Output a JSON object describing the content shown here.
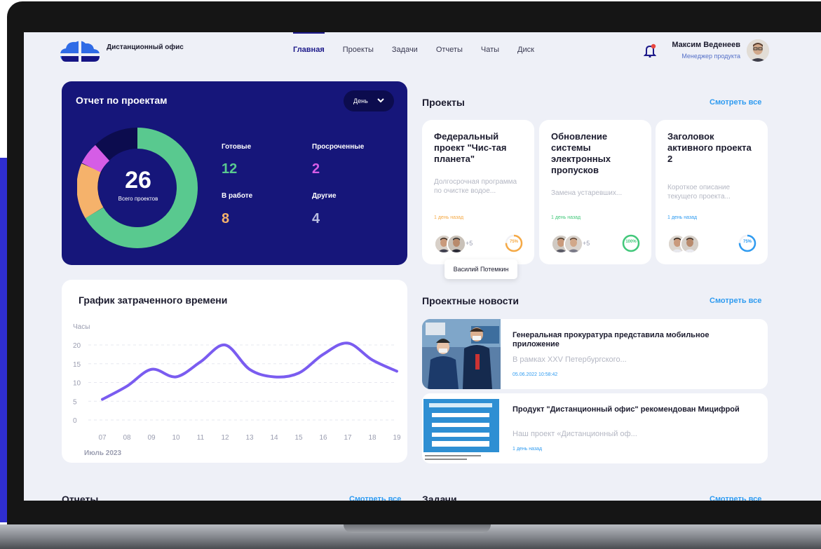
{
  "app": {
    "logo_text": "Дистанционный офис"
  },
  "nav": {
    "items": [
      {
        "label": "Главная",
        "active": true
      },
      {
        "label": "Проекты"
      },
      {
        "label": "Задачи"
      },
      {
        "label": "Отчеты"
      },
      {
        "label": "Чаты"
      },
      {
        "label": "Диск"
      }
    ]
  },
  "user": {
    "name": "Максим Веденеев",
    "role": "Менеджер продукта"
  },
  "report": {
    "title": "Отчет по проектам",
    "period": "День",
    "total": "26",
    "total_label": "Всего проектов",
    "stats": {
      "ready_label": "Готовые",
      "ready": "12",
      "overdue_label": "Просроченные",
      "overdue": "2",
      "in_work_label": "В работе",
      "in_work": "8",
      "other_label": "Другие",
      "other": "4"
    },
    "colors": {
      "ready": "#59c98f",
      "overdue": "#d55de6",
      "in_work": "#f5b26b",
      "other": "#0c0c4e"
    }
  },
  "projects": {
    "title": "Проекты",
    "see_all": "Смотреть все",
    "cards": [
      {
        "title": "Федеральный проект \"Чис-тая планета\"",
        "desc": "Долгосрочная программа по очистке водое...",
        "time": "1 день назад",
        "extra": "+5",
        "progress": "75%",
        "color": "#f5a945"
      },
      {
        "title": "Обновление системы электронных пропусков",
        "desc": "Замена устаревших...",
        "time": "1 день назад",
        "extra": "+5",
        "progress": "100%",
        "color": "#42c87a"
      },
      {
        "title": "Заголовок активного проекта 2",
        "desc": "Короткое описание текущего проекта...",
        "time": "1 день назад",
        "extra": "",
        "progress": "75%",
        "color": "#2f9bf0"
      }
    ],
    "tooltip": "Василий Потемкин"
  },
  "chart": {
    "title": "График затраченного времени",
    "ylabel": "Часы",
    "xlabel": "Июль 2023"
  },
  "chart_data": {
    "type": "line",
    "title": "График затраченного времени",
    "ylabel": "Часы",
    "xlabel": "Июль 2023",
    "x": [
      "07",
      "08",
      "09",
      "10",
      "11",
      "12",
      "13",
      "14",
      "15",
      "16",
      "17",
      "18",
      "19"
    ],
    "yticks": [
      0,
      5,
      10,
      15,
      20
    ],
    "ylim": [
      0,
      20
    ],
    "series": [
      {
        "color": "#7a5cf0",
        "values": [
          5.5,
          9,
          13.5,
          11.5,
          15.5,
          20,
          13.5,
          11.5,
          12.5,
          17.5,
          20.5,
          16,
          13
        ]
      }
    ],
    "grid": true
  },
  "news": {
    "title": "Проектные новости",
    "see_all": "Смотреть все",
    "items": [
      {
        "title": "Генеральная прокуратура представила мобильное приложение",
        "desc": "В рамках XXV Петербургского...",
        "date": "05.06.2022 10:58:42"
      },
      {
        "title": "Продукт \"Дистанционный офис\" рекомендован Мицифрой",
        "desc": "Наш проект «Дистанционный оф...",
        "date": "1 день назад"
      }
    ]
  },
  "bottom": {
    "reports_title": "Отчеты",
    "reports_see_all": "Смотреть все",
    "tasks_title": "Задачи",
    "tasks_see_all": "Смотреть все"
  }
}
